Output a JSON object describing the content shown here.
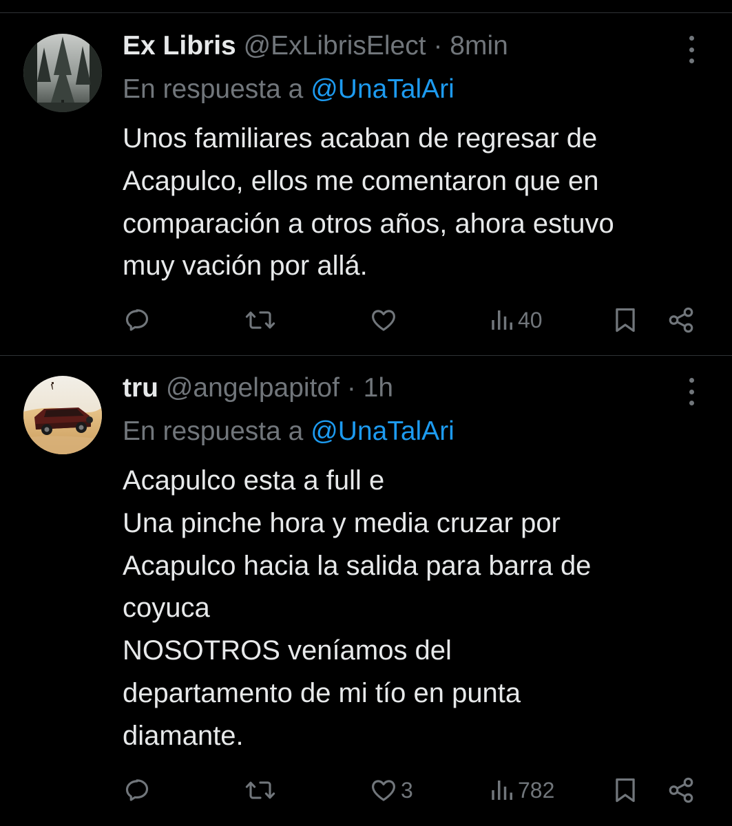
{
  "tweets": [
    {
      "display_name": "Ex Libris",
      "handle": "@ExLibrisElect",
      "dot": "·",
      "time": "8min",
      "reply_prefix": "En respuesta a",
      "reply_mention": "@UnaTalAri",
      "lines": [
        "Unos familiares acaban de regresar de",
        "Acapulco, ellos me comentaron que en",
        "comparación a otros años, ahora estuvo",
        "muy vación por allá."
      ],
      "like_count": "",
      "views_count": "40",
      "avatar_icon": "forest-avatar"
    },
    {
      "display_name": "tru",
      "handle": "@angelpapitof",
      "dot": "·",
      "time": "1h",
      "reply_prefix": "En respuesta a",
      "reply_mention": "@UnaTalAri",
      "lines": [
        "Acapulco esta a full e",
        "Una pinche hora y media cruzar por",
        "Acapulco hacia la salida para barra de",
        "coyuca",
        "NOSOTROS veníamos del",
        "departamento de mi tío en punta",
        "diamante."
      ],
      "like_count": "3",
      "views_count": "782",
      "avatar_icon": "desert-car-avatar"
    }
  ],
  "icons": {
    "reply": "reply-icon",
    "retweet": "retweet-icon",
    "like": "heart-icon",
    "views": "views-icon",
    "bookmark": "bookmark-icon",
    "share": "share-icon",
    "more": "more-icon"
  },
  "colors": {
    "background": "#000000",
    "text": "#e7e9ea",
    "secondary": "#71767b",
    "link": "#1d9bf0",
    "divider": "#2f3336"
  }
}
